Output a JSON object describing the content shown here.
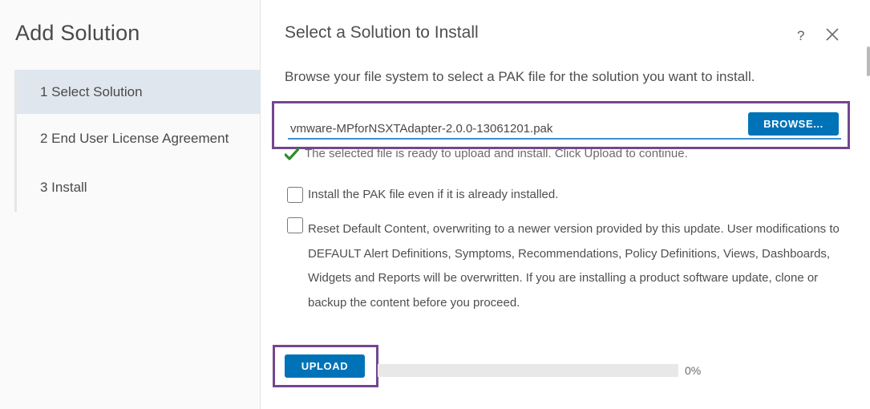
{
  "wizard": {
    "title": "Add Solution",
    "steps": [
      {
        "label": "1 Select Solution",
        "active": true
      },
      {
        "label": "2 End User License Agreement",
        "active": false
      },
      {
        "label": "3 Install",
        "active": false
      }
    ]
  },
  "dialog": {
    "title": "Select a Solution to Install",
    "help_label": "?",
    "instructions": "Browse your file system to select a PAK file for the solution you want to install.",
    "file_input": {
      "value": "vmware-MPforNSXTAdapter-2.0.0-13061201.pak",
      "browse_label": "BROWSE..."
    },
    "status_message": "The selected file is ready to upload and install. Click Upload to continue.",
    "options": [
      {
        "label": "Install the PAK file even if it is already installed.",
        "checked": false
      },
      {
        "label": "Reset Default Content, overwriting to a newer version provided by this update. User modifications to DEFAULT Alert Definitions, Symptoms, Recommendations, Policy Definitions, Views, Dashboards, Widgets and Reports will be overwritten. If you are installing a product software update, clone or backup the content before you proceed.",
        "checked": false
      }
    ],
    "upload": {
      "button_label": "UPLOAD",
      "progress_percent": 0,
      "progress_text": "0%"
    }
  },
  "colors": {
    "accent": "#0073b8",
    "highlight_border": "#75468f",
    "active_step_bg": "#dfe6ee",
    "success": "#2e8b2e"
  },
  "icons": {
    "help": "help-icon",
    "close": "close-icon",
    "status": "check-icon"
  }
}
